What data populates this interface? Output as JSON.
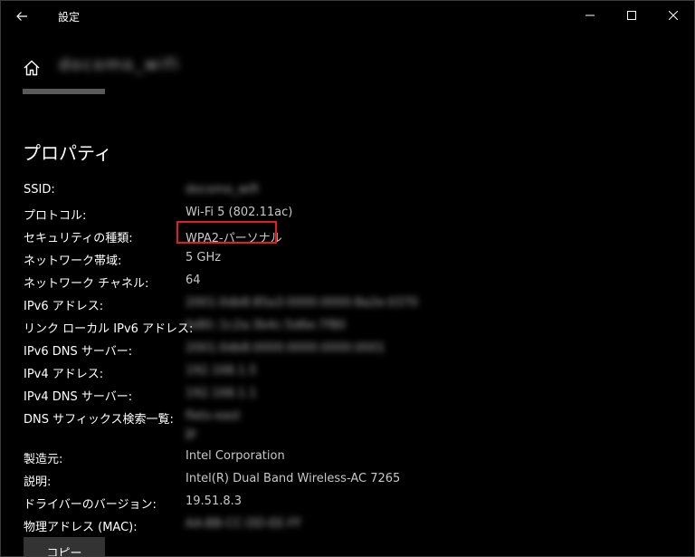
{
  "window": {
    "title": "設定"
  },
  "header": {
    "network_name": "docomo_wifi"
  },
  "section": {
    "title": "プロパティ"
  },
  "properties": [
    {
      "label": "SSID:",
      "value": "docomo_wifi"
    },
    {
      "label": "プロトコル:",
      "value": "Wi-Fi 5 (802.11ac)"
    },
    {
      "label": "セキュリティの種類:",
      "value": "WPA2-パーソナル"
    },
    {
      "label": "ネットワーク帯域:",
      "value": "5 GHz"
    },
    {
      "label": "ネットワーク チャネル:",
      "value": "64"
    },
    {
      "label": "IPv6 アドレス:",
      "value": "2001:0db8:85a3:0000:0000:8a2e:0370"
    },
    {
      "label": "リンク ローカル IPv6 アドレス:",
      "value": "fe80::1c2a:3b4c:5d6e:7f80"
    },
    {
      "label": "IPv6 DNS サーバー:",
      "value": "2001:0db8:0000:0000:0000:0001"
    },
    {
      "label": "IPv4 アドレス:",
      "value": "192.168.1.5"
    },
    {
      "label": "IPv4 DNS サーバー:",
      "value": "192.168.1.1"
    },
    {
      "label": "DNS サフィックス検索一覧:",
      "value": "flets-east",
      "value2": "jp"
    },
    {
      "label": "製造元:",
      "value": "Intel Corporation"
    },
    {
      "label": "説明:",
      "value": "Intel(R) Dual Band Wireless-AC 7265"
    },
    {
      "label": "ドライバーのバージョン:",
      "value": "19.51.8.3"
    },
    {
      "label": "物理アドレス (MAC):",
      "value": "AA-BB-CC-DD-EE-FF"
    }
  ],
  "copy_button": {
    "label": "コピー"
  },
  "colors": {
    "background": "#000000",
    "highlight": "#e02020",
    "button": "#333333"
  }
}
